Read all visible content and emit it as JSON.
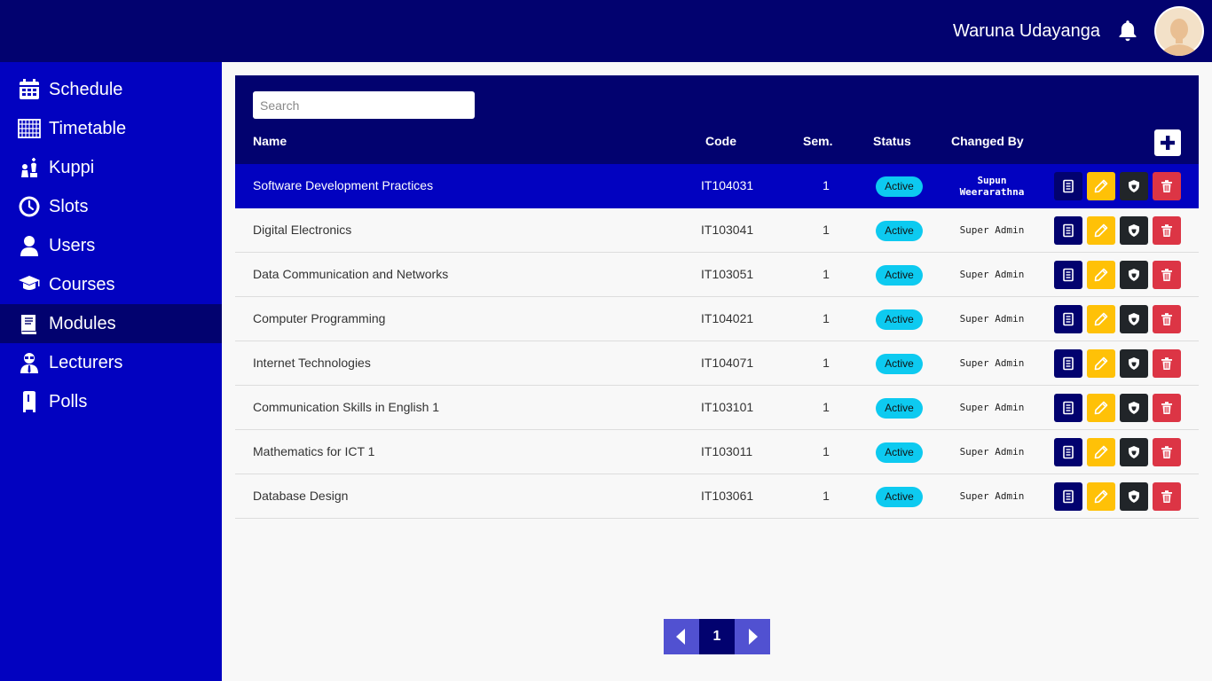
{
  "header": {
    "user_name": "Waruna Udayanga",
    "bell_icon": "bell-icon",
    "avatar_icon": "user-avatar"
  },
  "sidebar": {
    "items": [
      {
        "label": "Schedule",
        "icon": "calendar-icon"
      },
      {
        "label": "Timetable",
        "icon": "grid-table-icon"
      },
      {
        "label": "Kuppi",
        "icon": "chess-icon"
      },
      {
        "label": "Slots",
        "icon": "clock-icon"
      },
      {
        "label": "Users",
        "icon": "user-icon"
      },
      {
        "label": "Courses",
        "icon": "graduation-cap-icon"
      },
      {
        "label": "Modules",
        "icon": "book-icon",
        "active": true
      },
      {
        "label": "Lecturers",
        "icon": "lecturer-icon"
      },
      {
        "label": "Polls",
        "icon": "ballot-box-icon"
      }
    ]
  },
  "table": {
    "search_placeholder": "Search",
    "columns": {
      "name": "Name",
      "code": "Code",
      "sem": "Sem.",
      "status": "Status",
      "changed_by": "Changed By"
    },
    "add_icon": "plus-icon",
    "rows": [
      {
        "name": "Software Development Practices",
        "code": "IT104031",
        "sem": "1",
        "status": "Active",
        "changed_by": "Supun Weerarathna",
        "selected": true
      },
      {
        "name": "Digital Electronics",
        "code": "IT103041",
        "sem": "1",
        "status": "Active",
        "changed_by": "Super Admin"
      },
      {
        "name": "Data Communication and Networks",
        "code": "IT103051",
        "sem": "1",
        "status": "Active",
        "changed_by": "Super Admin"
      },
      {
        "name": "Computer Programming",
        "code": "IT104021",
        "sem": "1",
        "status": "Active",
        "changed_by": "Super Admin"
      },
      {
        "name": "Internet Technologies",
        "code": "IT104071",
        "sem": "1",
        "status": "Active",
        "changed_by": "Super Admin"
      },
      {
        "name": "Communication Skills in English 1",
        "code": "IT103101",
        "sem": "1",
        "status": "Active",
        "changed_by": "Super Admin"
      },
      {
        "name": "Mathematics for ICT 1",
        "code": "IT103011",
        "sem": "1",
        "status": "Active",
        "changed_by": "Super Admin"
      },
      {
        "name": "Database Design",
        "code": "IT103061",
        "sem": "1",
        "status": "Active",
        "changed_by": "Super Admin"
      }
    ],
    "row_actions": [
      "view-details-icon",
      "edit-pencil-icon",
      "permissions-shield-icon",
      "delete-trash-icon"
    ]
  },
  "pagination": {
    "current_page": "1",
    "prev_icon": "caret-left-icon",
    "next_icon": "caret-right-icon"
  },
  "colors": {
    "header_bg": "#02026f",
    "sidebar_bg": "#0202c0",
    "selected_row": "#0202c0",
    "status_badge": "#0dcaf0",
    "edit_button": "#ffc107",
    "permissions_button": "#212529",
    "delete_button": "#dc3545",
    "pager_arrow": "#5151d1"
  }
}
